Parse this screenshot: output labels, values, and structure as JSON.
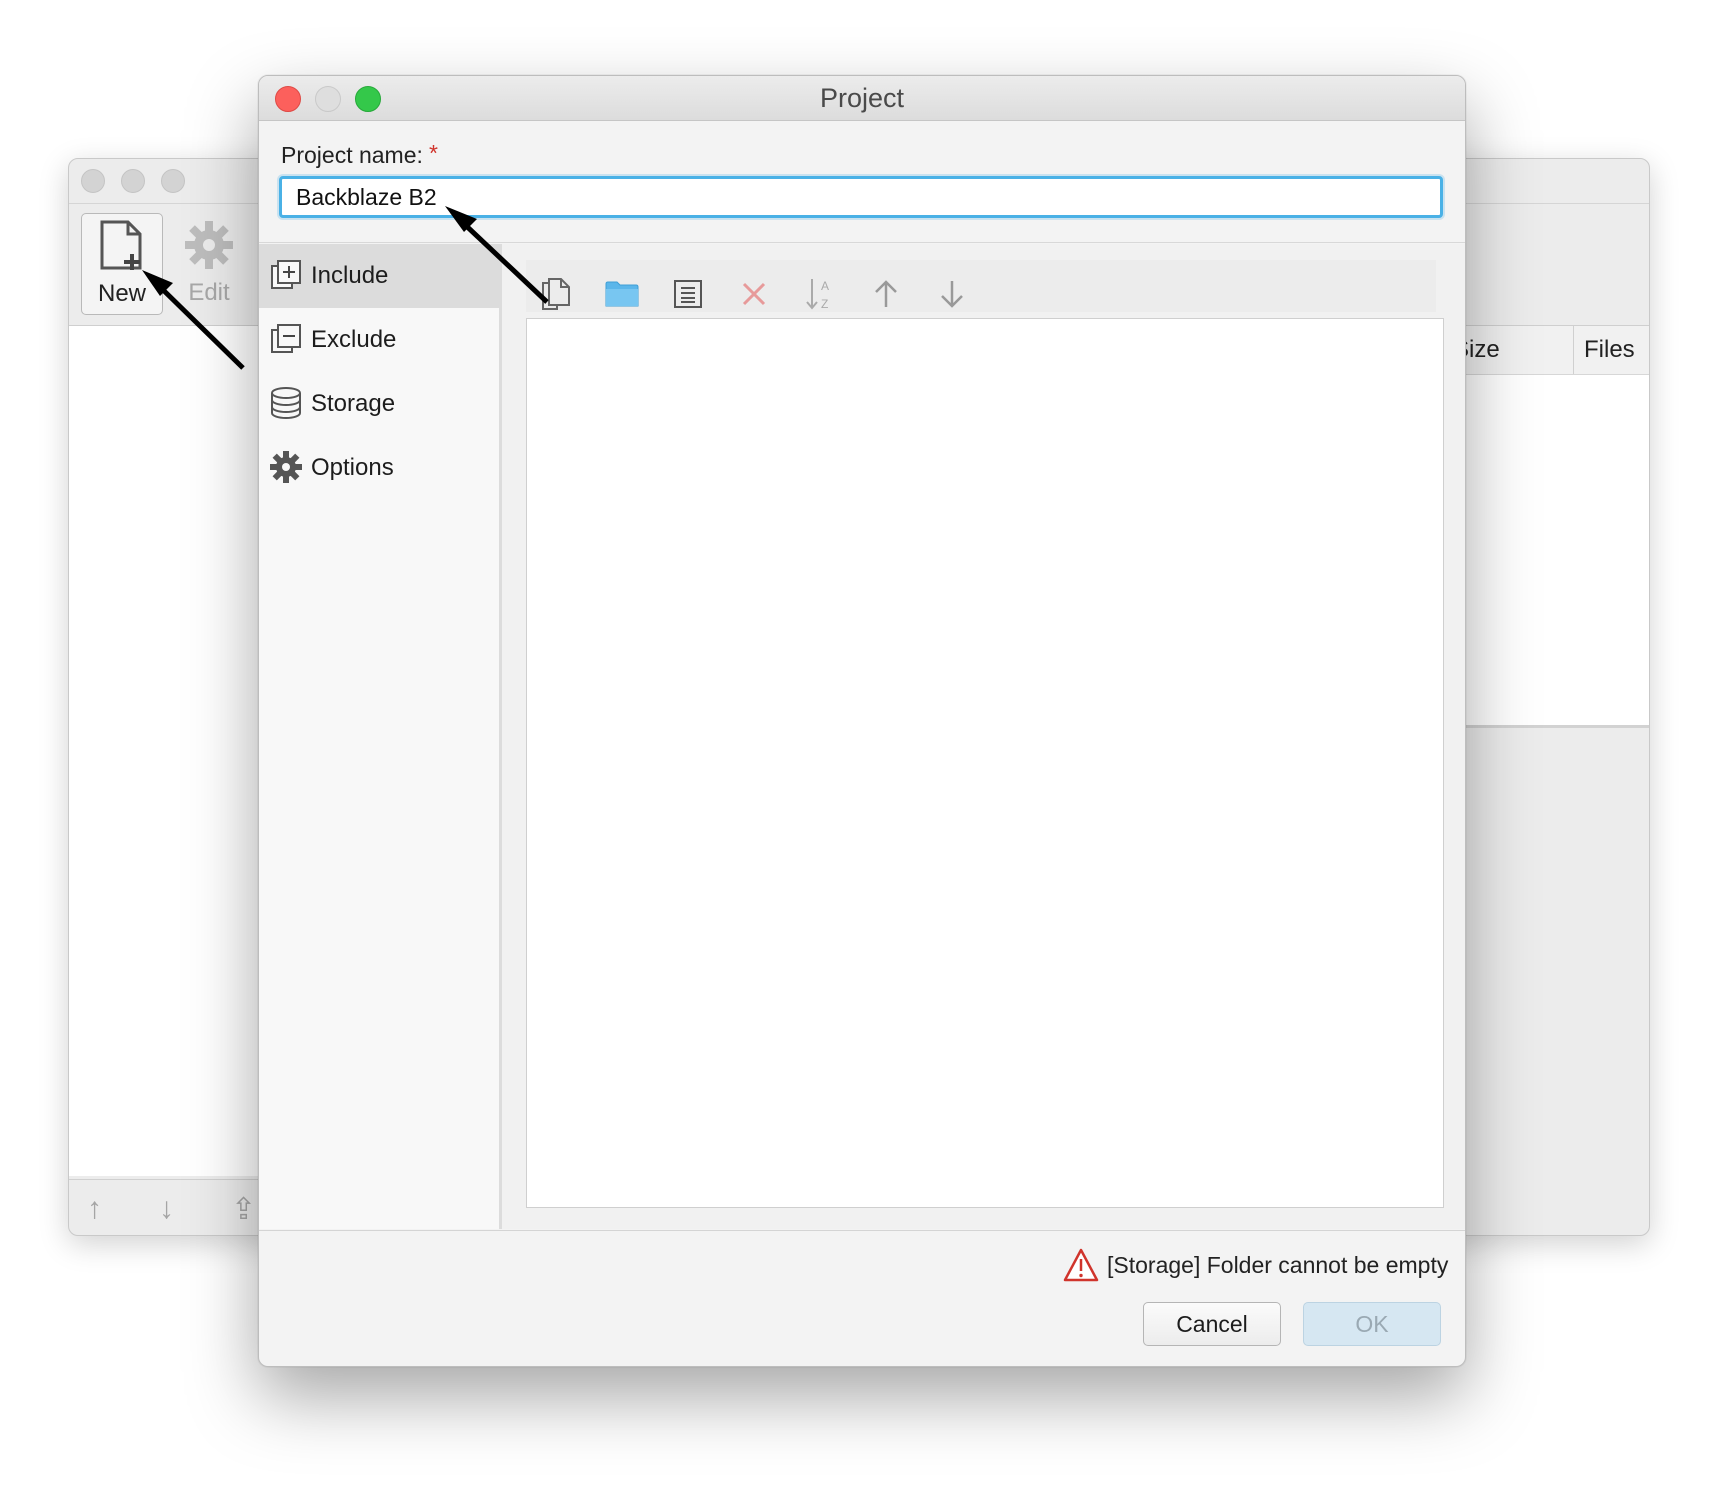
{
  "background_window": {
    "toolbar": {
      "new_label": "New",
      "edit_label": "Edit"
    },
    "table": {
      "columns": [
        "Size",
        "Files"
      ]
    }
  },
  "dialog": {
    "title": "Project",
    "name_field": {
      "label": "Project name:",
      "required_marker": "*",
      "value": "Backblaze B2"
    },
    "sidebar": {
      "items": [
        {
          "label": "Include",
          "icon": "include-icon",
          "active": true
        },
        {
          "label": "Exclude",
          "icon": "exclude-icon",
          "active": false
        },
        {
          "label": "Storage",
          "icon": "database-icon",
          "active": false
        },
        {
          "label": "Options",
          "icon": "gear-icon",
          "active": false
        }
      ]
    },
    "toolbar": {
      "buttons": [
        "copy-file-icon",
        "folder-icon",
        "list-document-icon",
        "delete-icon",
        "sort-az-icon",
        "arrow-up-icon",
        "arrow-down-icon"
      ]
    },
    "footer": {
      "error_message": "[Storage] Folder cannot be empty",
      "cancel_label": "Cancel",
      "ok_label": "OK"
    }
  },
  "colors": {
    "accent": "#4ab1e6",
    "close": "#fc605c",
    "maximize": "#34c84a",
    "error": "#d0342c",
    "folder": "#5bb6ea"
  }
}
